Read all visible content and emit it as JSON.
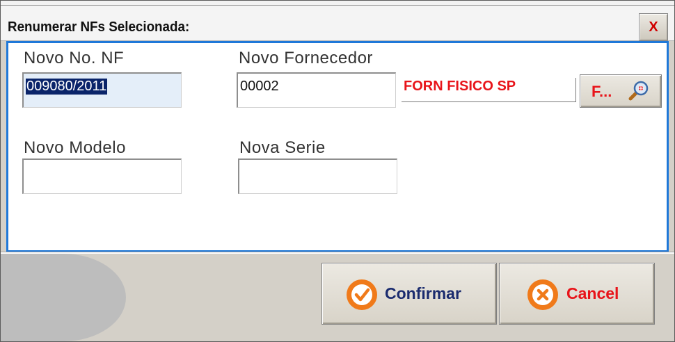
{
  "dialog": {
    "title": "Renumerar NFs Selecionada:",
    "close_label": "X"
  },
  "form": {
    "nf": {
      "label": "Novo No. NF",
      "value": "009080/2011"
    },
    "fornecedor": {
      "label": "Novo Fornecedor",
      "value": "00002",
      "name": "FORN FISICO SP"
    },
    "find_button_label": "F...",
    "modelo": {
      "label": "Novo Modelo",
      "value": ""
    },
    "serie": {
      "label": "Nova Serie",
      "value": ""
    }
  },
  "footer": {
    "confirm_label": "Confirmar",
    "cancel_label": "Cancel"
  },
  "icons": {
    "confirm": "check-circle-icon",
    "cancel": "x-circle-icon",
    "find": "magnifier-icon"
  },
  "colors": {
    "panel_border": "#1f78d8",
    "accent_red": "#e8141a",
    "confirm_text": "#1a2b6e",
    "icon_orange": "#f07a1a"
  }
}
